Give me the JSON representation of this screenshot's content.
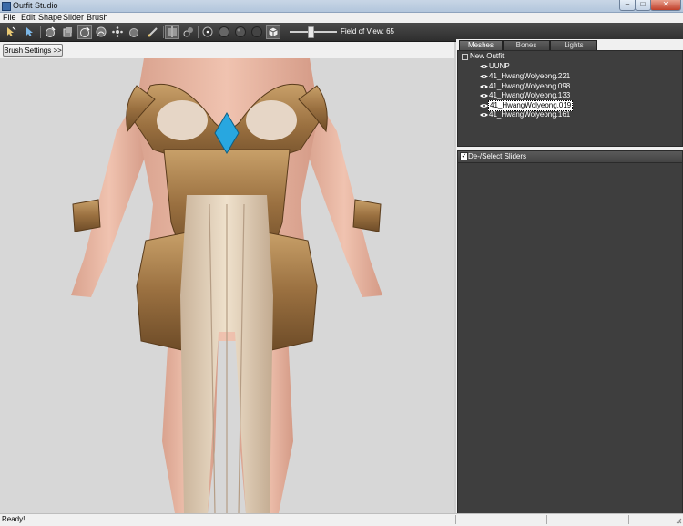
{
  "window": {
    "title": "Outfit Studio",
    "minimize": "–",
    "maximize": "□",
    "close": "✕"
  },
  "menu": [
    {
      "label": "File"
    },
    {
      "label": "Edit"
    },
    {
      "label": "Shape"
    },
    {
      "label": "Slider"
    },
    {
      "label": "Brush"
    }
  ],
  "toolbar": {
    "icons": [
      "select-tool-icon",
      "transform-tool-icon",
      "inflate-brush-icon",
      "deflate-brush-icon",
      "move-brush-icon",
      "smooth-brush-icon",
      "mask-brush-icon",
      "unmask-brush-icon",
      "weight-brush-icon",
      "color-brush-icon",
      "symmetry-icon",
      "wireframe-icon",
      "point-icon",
      "circle-icon",
      "sphere-icon",
      "texture-icon",
      "cube-icon"
    ],
    "fov_label": "Field of View: 65",
    "fov_value": 65
  },
  "viewport": {
    "brush_settings_label": "Brush Settings >>"
  },
  "tabs": [
    {
      "label": "Meshes",
      "active": true
    },
    {
      "label": "Bones",
      "active": false
    },
    {
      "label": "Lights",
      "active": false
    }
  ],
  "tree": {
    "root": "New Outfit",
    "meshes": [
      {
        "label": "UUNP",
        "selected": false
      },
      {
        "label": "41_HwangWolyeong.221",
        "selected": false
      },
      {
        "label": "41_HwangWolyeong.098",
        "selected": false
      },
      {
        "label": "41_HwangWolyeong.133",
        "selected": false
      },
      {
        "label": "41_HwangWolyeong.019",
        "selected": true
      },
      {
        "label": "41_HwangWolyeong.161",
        "selected": false
      }
    ]
  },
  "sliders": {
    "label": "De-/Select Sliders",
    "checked": true
  },
  "status": {
    "text": "Ready!"
  },
  "colors": {
    "toolbar_bg": "#3a3a3a",
    "panel_bg": "#3e3e3e",
    "viewport_bg": "#d7d7d7",
    "gem": "#28a7e0",
    "armor": "#a07a46"
  }
}
